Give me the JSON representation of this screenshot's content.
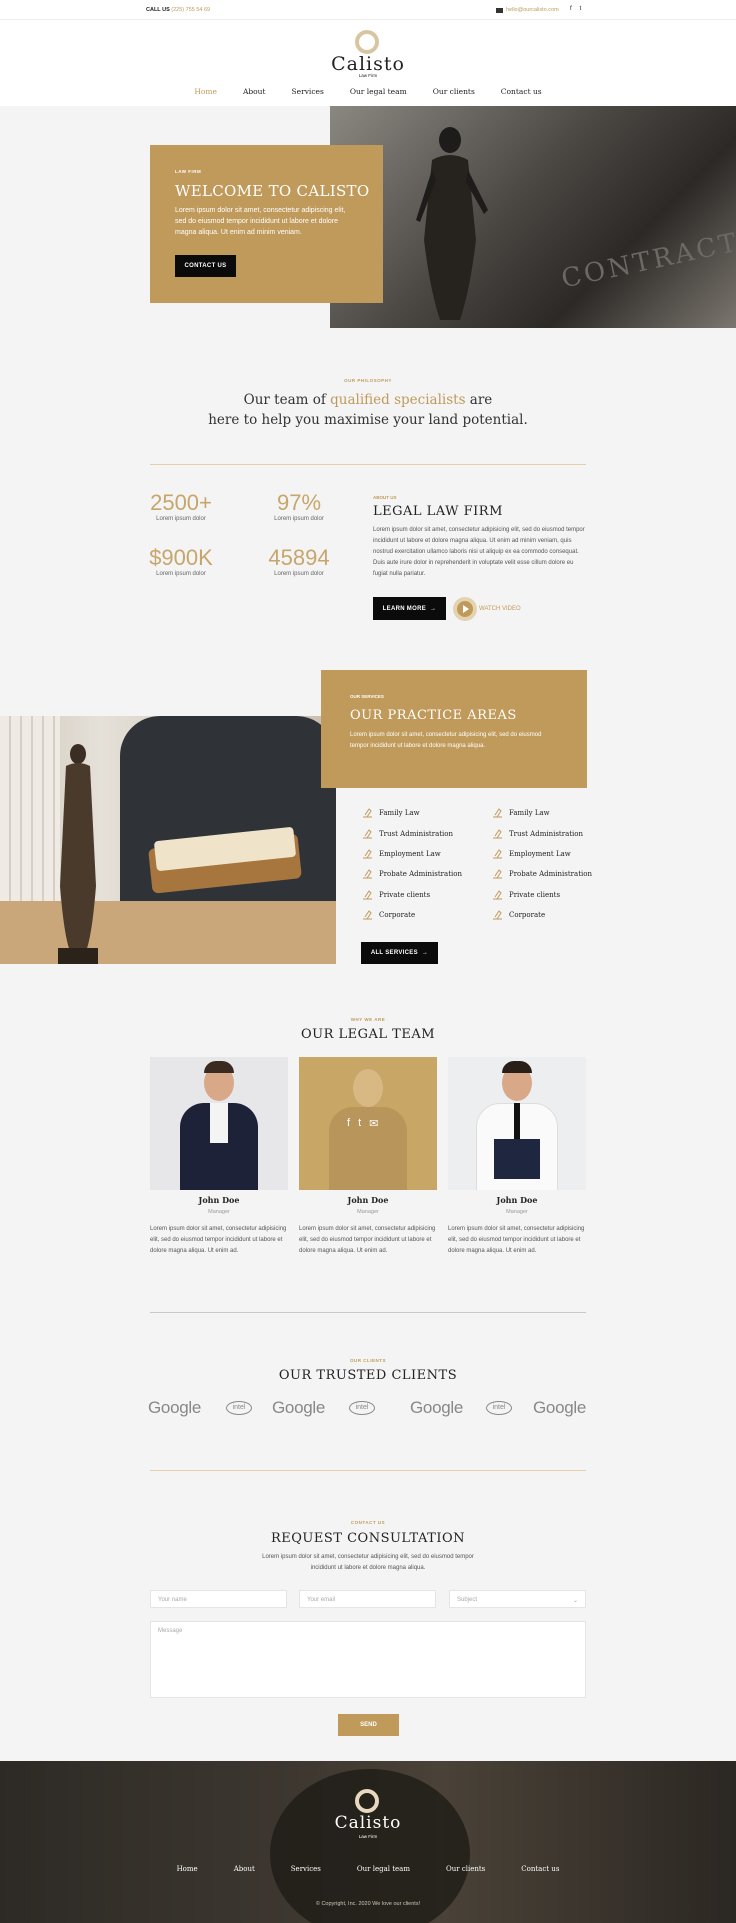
{
  "topbar": {
    "call_label": "CALL US",
    "phone": "(225) 755 54 69",
    "email": "hello@ourcalisto.com",
    "social": [
      "f",
      "t"
    ]
  },
  "brand": {
    "name": "Calisto",
    "tagline": "Law Firm"
  },
  "nav": [
    "Home",
    "About",
    "Services",
    "Our legal team",
    "Our clients",
    "Contact us"
  ],
  "hero": {
    "kicker": "LAW FIRM",
    "title": "WELCOME TO CALISTO",
    "text": "Lorem ipsum dolor sit amet, consectetur adipiscing elit, sed do eiusmod tempor incididunt ut labore et dolore magna aliqua. Ut enim ad minim veniam.",
    "button": "CONTACT US"
  },
  "philosophy": {
    "kicker": "OUR PHILOSOPHY",
    "line1_a": "Our team of ",
    "line1_b": "qualified specialists",
    "line1_c": " are",
    "line2": "here to help you maximise your land potential."
  },
  "stats": [
    {
      "value": "2500+",
      "label": "Lorem ipsum dolor"
    },
    {
      "value": "97%",
      "label": "Lorem ipsum dolor"
    },
    {
      "value": "$900K",
      "label": "Lorem ipsum dolor"
    },
    {
      "value": "45894",
      "label": "Lorem ipsum dolor"
    }
  ],
  "about": {
    "kicker": "ABOUT US",
    "title": "LEGAL LAW FIRM",
    "text": "Lorem ipsum dolor sit amet, consectetur adipisicing elit, sed do eiusmod tempor incididunt ut labore et dolore magna aliqua. Ut enim ad minim veniam, quis nostrud exercitation ullamco laboris nisi ut aliquip ex ea commodo consequat. Duis aute irure dolor in reprehenderit in voluptate velit esse cillum dolore eu fugiat nulla pariatur.",
    "button": "LEARN MORE",
    "video": "WATCH VIDEO"
  },
  "services": {
    "kicker": "OUR SERVICES",
    "title": "OUR PRACTICE AREAS",
    "text": "Lorem ipsum dolor sit amet, consectetur adipisicing elit, sed do eiusmod tempor incididunt ut labore et dolore magna aliqua.",
    "areas_left": [
      "Family Law",
      "Trust Administration",
      "Employment Law",
      "Probate Administration",
      "Private clients",
      "Corporate"
    ],
    "areas_right": [
      "Family Law",
      "Trust Administration",
      "Employment Law",
      "Probate Administration",
      "Private clients",
      "Corporate"
    ],
    "button": "ALL SERVICES"
  },
  "team": {
    "kicker": "WHY WE ARE",
    "title": "OUR LEGAL TEAM",
    "members": [
      {
        "name": "John Doe",
        "role": "Manager",
        "bio": "Lorem ipsum dolor sit amet, consectetur adipisicing elit, sed do eiusmod tempor incididunt ut labore et dolore magna aliqua. Ut enim ad."
      },
      {
        "name": "John Doe",
        "role": "Manager",
        "bio": "Lorem ipsum dolor sit amet, consectetur adipisicing elit, sed do eiusmod tempor incididunt ut labore et dolore magna aliqua. Ut enim ad."
      },
      {
        "name": "John Doe",
        "role": "Manager",
        "bio": "Lorem ipsum dolor sit amet, consectetur adipisicing elit, sed do eiusmod tempor incididunt ut labore et dolore magna aliqua. Ut enim ad."
      }
    ]
  },
  "clients": {
    "kicker": "OUR CLIENTS",
    "title": "OUR TRUSTED CLIENTS",
    "logos": [
      "Google",
      "intel",
      "Google",
      "intel",
      "Google",
      "intel",
      "Google"
    ]
  },
  "contact": {
    "kicker": "CONTACT US",
    "title": "REQUEST CONSULTATION",
    "text": "Lorem ipsum dolor sit amet, consectetur adipisicing elit, sed do eiusmod tempor incididunt ut labore et dolore magna aliqua.",
    "name_ph": "Your name",
    "email_ph": "Your email",
    "subject_ph": "Subject",
    "message_ph": "Message",
    "button": "SEND"
  },
  "footer": {
    "name": "Calisto",
    "tagline": "Law Firm",
    "nav": [
      "Home",
      "About",
      "Services",
      "Our legal team",
      "Our clients",
      "Contact us"
    ],
    "copyright": "© Copyright, Inc. 2020 We love our clients!"
  },
  "colors": {
    "accent": "#bf9a5b",
    "dark": "#0b0b0b"
  }
}
